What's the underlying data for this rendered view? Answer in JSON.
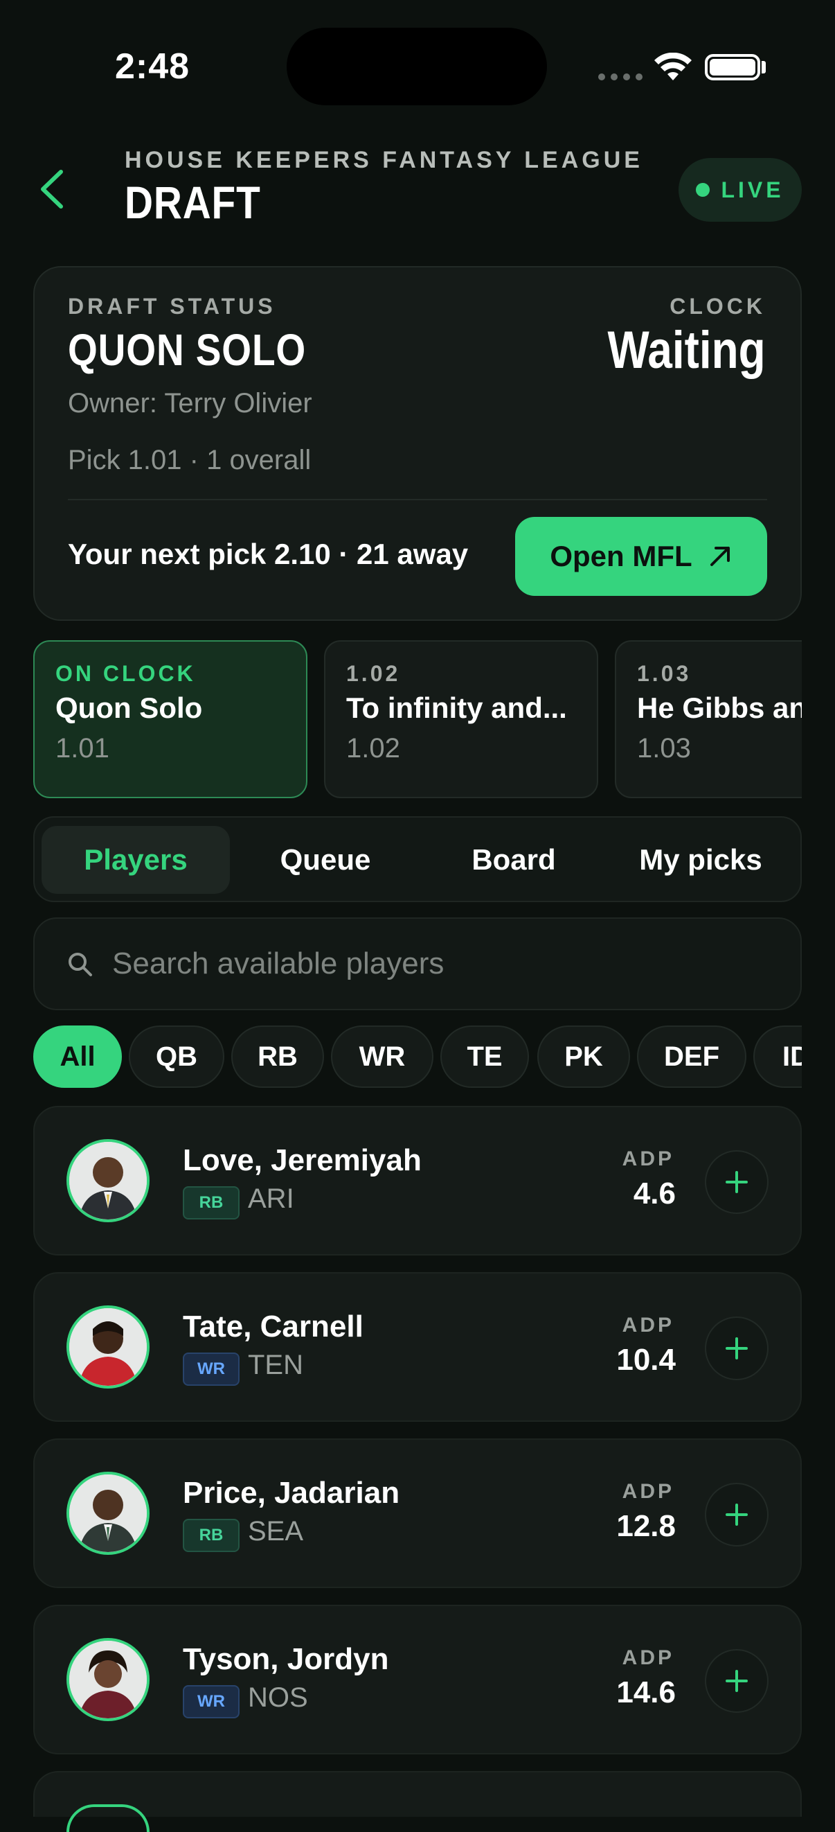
{
  "status_bar": {
    "time": "2:48"
  },
  "header": {
    "league_name": "HOUSE KEEPERS FANTASY LEAGUE",
    "title": "DRAFT",
    "live_label": "LIVE",
    "accent_color": "#35d47e"
  },
  "status_card": {
    "label": "DRAFT STATUS",
    "team": "QUON SOLO",
    "owner": "Owner: Terry Olivier",
    "pick": "Pick 1.01 · 1 overall",
    "clock_label": "CLOCK",
    "clock_value": "Waiting",
    "next_pick": "Your next pick 2.10 · 21 away",
    "open_button": "Open MFL"
  },
  "pick_cards": [
    {
      "label": "ON CLOCK",
      "team": "Quon Solo",
      "pick": "1.01"
    },
    {
      "label": "1.02",
      "team": "To infinity and...",
      "pick": "1.02"
    },
    {
      "label": "1.03",
      "team": "He Gibbs and",
      "pick": "1.03"
    }
  ],
  "tabs": [
    "Players",
    "Queue",
    "Board",
    "My picks"
  ],
  "search": {
    "placeholder": "Search available players"
  },
  "filters": [
    "All",
    "QB",
    "RB",
    "WR",
    "TE",
    "PK",
    "DEF",
    "IDP"
  ],
  "players": [
    {
      "name": "Love, Jeremiyah",
      "position": "RB",
      "team": "ARI",
      "adp_label": "ADP",
      "adp": "4.6"
    },
    {
      "name": "Tate, Carnell",
      "position": "WR",
      "team": "TEN",
      "adp_label": "ADP",
      "adp": "10.4"
    },
    {
      "name": "Price, Jadarian",
      "position": "RB",
      "team": "SEA",
      "adp_label": "ADP",
      "adp": "12.8"
    },
    {
      "name": "Tyson, Jordyn",
      "position": "WR",
      "team": "NOS",
      "adp_label": "ADP",
      "adp": "14.6"
    }
  ]
}
